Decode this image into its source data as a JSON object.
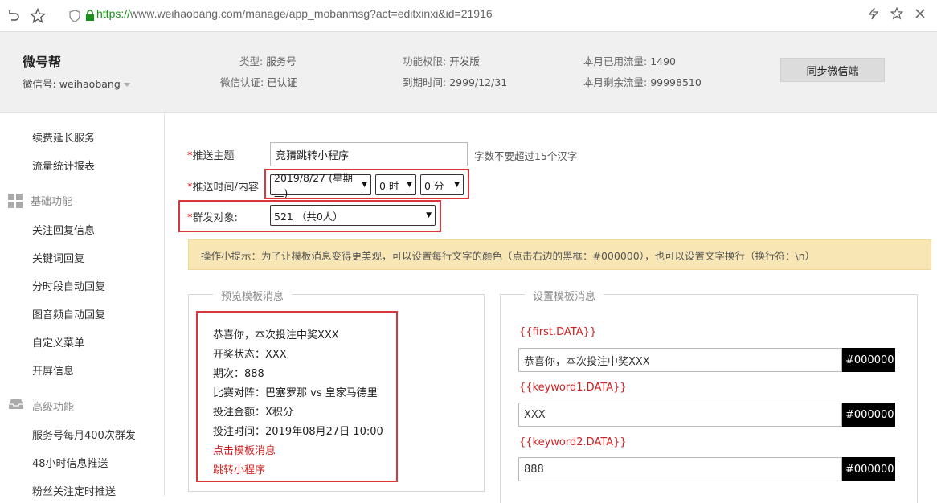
{
  "browser": {
    "url_https": "https://",
    "url_rest": "www.weihaobang.com/manage/app_mobanmsg?act=editxinxi&id=21916"
  },
  "account": {
    "brand": "微号帮",
    "wechat_id_label": "微信号:",
    "wechat_id": "weihaobang",
    "type_label": "类型:",
    "type_value": "服务号",
    "verify_label": "微信认证:",
    "verify_value": "已认证",
    "perm_label": "功能权限:",
    "perm_value": "开发版",
    "expire_label": "到期时间:",
    "expire_value": "2999/12/31",
    "used_label": "本月已用流量:",
    "used_value": "1490",
    "remain_label": "本月剩余流量:",
    "remain_value": "99998510",
    "sync_button": "同步微信端"
  },
  "sidebar": {
    "items_top": [
      "续费延长服务",
      "流量统计报表"
    ],
    "group_basic": "基础功能",
    "items_basic": [
      "关注回复信息",
      "关键词回复",
      "分时段自动回复",
      "图音频自动回复",
      "自定义菜单",
      "开屏信息"
    ],
    "group_advanced": "高级功能",
    "items_advanced": [
      "服务号每月400次群发",
      "48小时信息推送",
      "粉丝关注定时推送"
    ]
  },
  "form": {
    "topic_label": "推送主题",
    "topic_value": "竞猜跳转小程序",
    "topic_hint": "字数不要超过15个汉字",
    "time_label": "推送时间/内容",
    "date_select": "2019/8/27 (星期二)",
    "hour_select": "0 时",
    "minute_select": "0 分",
    "target_label": "群发对象:",
    "target_select": "521 （共0人）",
    "required_mark": "*"
  },
  "tip": "操作小提示：为了让模板消息变得更美观，可以设置每行文字的颜色（点击右边的黑框：#000000），也可以设置文字换行（换行符：\\n）",
  "preview": {
    "title": "预览模板消息",
    "lines": [
      "恭喜你，本次投注中奖XXX",
      "开奖状态：XXX",
      "期次：888",
      "比赛对阵：巴塞罗那 vs 皇家马德里",
      "投注金额：X积分",
      "投注时间：2019年08月27日 10:00"
    ],
    "links": [
      "点击模板消息",
      "跳转小程序"
    ]
  },
  "settings": {
    "title": "设置模板消息",
    "fields": [
      {
        "key": "{{first.DATA}}",
        "value": "恭喜你，本次投注中奖XXX",
        "color": "#000000"
      },
      {
        "key": "{{keyword1.DATA}}",
        "value": "XXX",
        "color": "#000000"
      },
      {
        "key": "{{keyword2.DATA}}",
        "value": "888",
        "color": "#000000"
      }
    ]
  }
}
